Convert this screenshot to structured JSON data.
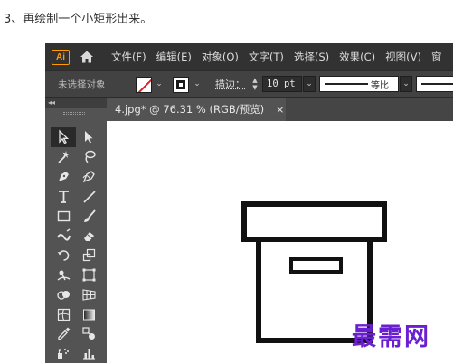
{
  "caption": "3、再绘制一个小矩形出来。",
  "app": {
    "logo_text": "Ai",
    "accent_color": "#ff9a00"
  },
  "menubar": {
    "items": [
      "文件(F)",
      "编辑(E)",
      "对象(O)",
      "文字(T)",
      "选择(S)",
      "效果(C)",
      "视图(V)",
      "窗"
    ]
  },
  "controlbar": {
    "selection_status": "未选择对象",
    "stroke_label": "描边：",
    "stroke_weight": "10 pt",
    "profile_label": "等比"
  },
  "toolpanel": {
    "header_glyph": "◂◂",
    "tools": [
      {
        "name": "selection-tool-icon",
        "active": true
      },
      {
        "name": "direct-selection-tool-icon"
      },
      {
        "name": "magic-wand-tool-icon"
      },
      {
        "name": "lasso-tool-icon"
      },
      {
        "name": "pen-tool-icon"
      },
      {
        "name": "curvature-tool-icon"
      },
      {
        "name": "type-tool-icon"
      },
      {
        "name": "line-segment-tool-icon"
      },
      {
        "name": "rectangle-tool-icon"
      },
      {
        "name": "paintbrush-tool-icon"
      },
      {
        "name": "shaper-tool-icon"
      },
      {
        "name": "eraser-tool-icon"
      },
      {
        "name": "rotate-tool-icon"
      },
      {
        "name": "scale-tool-icon"
      },
      {
        "name": "warp-tool-icon"
      },
      {
        "name": "free-transform-tool-icon"
      },
      {
        "name": "shape-builder-tool-icon"
      },
      {
        "name": "perspective-grid-tool-icon"
      },
      {
        "name": "mesh-tool-icon"
      },
      {
        "name": "gradient-tool-icon"
      },
      {
        "name": "eyedropper-tool-icon"
      },
      {
        "name": "blend-tool-icon"
      },
      {
        "name": "symbol-sprayer-tool-icon"
      },
      {
        "name": "column-graph-tool-icon"
      }
    ]
  },
  "document": {
    "tab_title": "4.jpg* @ 76.31 % (RGB/预览)",
    "close_glyph": "×"
  },
  "watermark": "最需网"
}
